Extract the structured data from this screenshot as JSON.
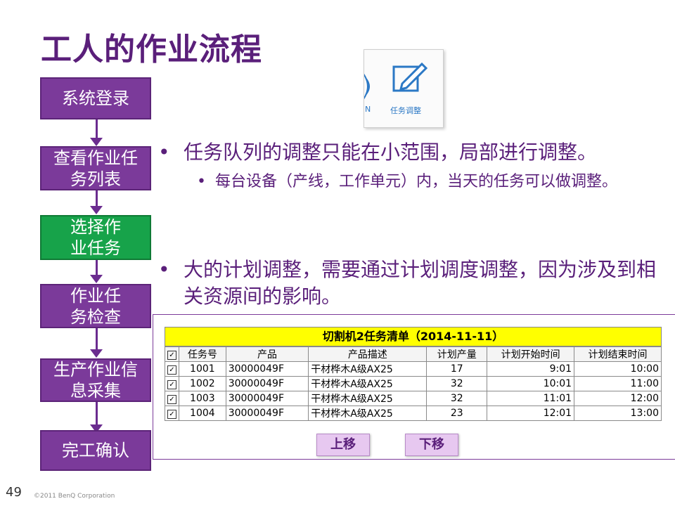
{
  "title": "工人的作业流程",
  "steps": [
    {
      "label": "系统登录"
    },
    {
      "label": "查看作业任务列表"
    },
    {
      "label": "选择作业任务"
    },
    {
      "label": "作业任务检查"
    },
    {
      "label": "生产作业信息采集"
    },
    {
      "label": "完工确认"
    }
  ],
  "icon": {
    "n_label": "N",
    "caption": "任务调整",
    "name": "edit-icon"
  },
  "bullets": {
    "b1": "任务队列的调整只能在小范围，局部进行调整。",
    "b2": "每台设备（产线，工作单元）内，当天的任务可以做调整。",
    "b3": "大的计划调整，需要通过计划调度调整，因为涉及到相关资源间的影响。",
    "dot": "•"
  },
  "task_table": {
    "title": "切割机2任务清单（2014-11-11）",
    "headers": [
      "任务号",
      "产品",
      "产品描述",
      "计划产量",
      "计划开始时间",
      "计划结束时间"
    ],
    "rows": [
      [
        "1001",
        "30000049F",
        "干材桦木A级AX25",
        "17",
        "9:01",
        "10:00"
      ],
      [
        "1002",
        "30000049F",
        "干材桦木A级AX25",
        "32",
        "10:01",
        "11:00"
      ],
      [
        "1003",
        "30000049F",
        "干材桦木A级AX25",
        "32",
        "11:01",
        "12:00"
      ],
      [
        "1004",
        "30000049F",
        "干材桦木A级AX25",
        "23",
        "12:01",
        "13:00"
      ]
    ],
    "check": "✓"
  },
  "buttons": {
    "up": "上移",
    "down": "下移"
  },
  "footer": {
    "page": "49",
    "copyright": "©2011 BenQ Corporation"
  },
  "colors": {
    "primary": "#5a1f7a",
    "step": "#7b3a9a",
    "active_step": "#17a34a",
    "table_title": "#ffff00"
  }
}
